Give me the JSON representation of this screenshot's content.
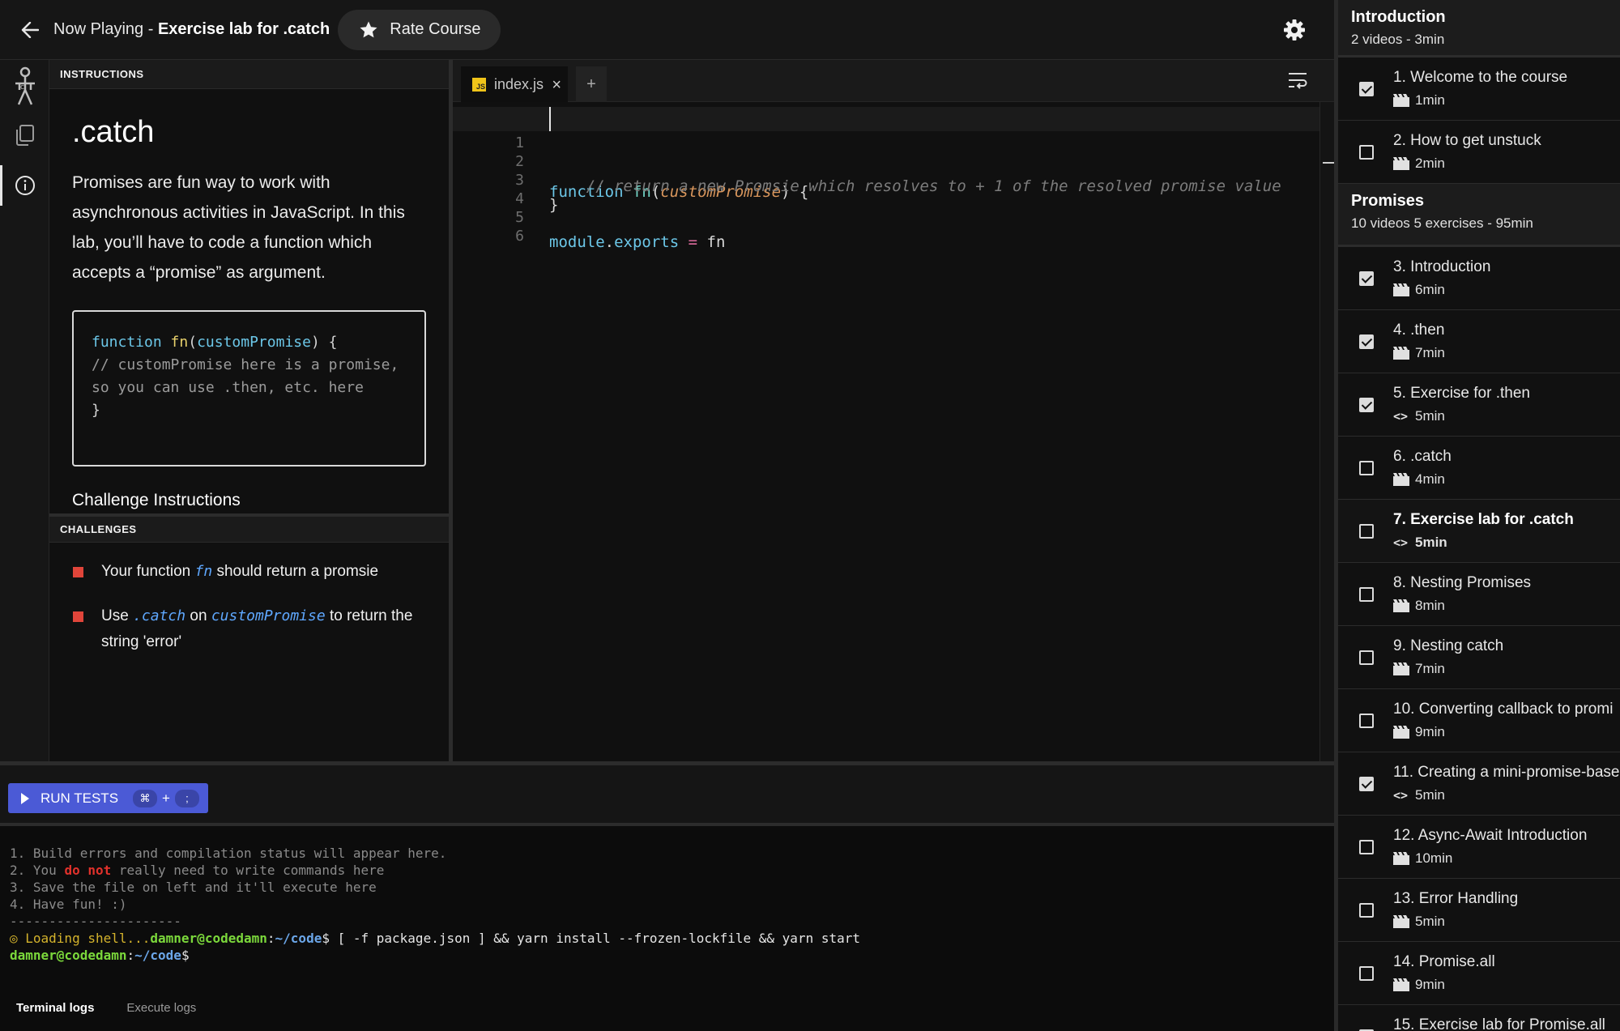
{
  "header": {
    "prefix": "Now Playing - ",
    "title": "Exercise lab for .catch",
    "rate_label": "Rate Course"
  },
  "instructions": {
    "panel_label": "INSTRUCTIONS",
    "title": ".catch",
    "description": "Promises are fun way to work with asynchronous activities in JavaScript. In this lab, you’ll have to code a function which accepts a “promise” as argument.",
    "code_sample": {
      "line1_kw": "function",
      "line1_fn": "fn",
      "line1_param": "customPromise",
      "comment": "// customPromise here is a promise, so you can use .then, etc. here",
      "close": "}"
    },
    "challenge_heading": "Challenge Instructions"
  },
  "challenges": {
    "panel_label": "CHALLENGES",
    "items": [
      {
        "pre": "Your function ",
        "code": "fn",
        "post": " should return a promsie"
      },
      {
        "pre": "Use ",
        "code": ".catch",
        "mid": " on ",
        "code2": "customPromise",
        "post": " to return the string 'error'"
      }
    ],
    "status_color": "#e0453a"
  },
  "editor": {
    "tab_name": "index.js",
    "tab_icon": "JS",
    "add_tab": "+",
    "lines": [
      {
        "n": "1",
        "kw": "function",
        "fn": "fn",
        "param": "customPromise",
        "tail": ") {"
      },
      {
        "n": "2",
        "comment": "    // return a new Promsie which resolves to + 1 of the resolved promise value"
      },
      {
        "n": "3",
        "text": "}"
      },
      {
        "n": "4",
        "text": ""
      },
      {
        "n": "5",
        "v1": "module",
        "dot": ".",
        "v2": "exports",
        "op": " = ",
        "rest": "fn"
      },
      {
        "n": "6",
        "text": ""
      }
    ]
  },
  "run": {
    "label": "RUN TESTS",
    "key1": "⌘",
    "plus": "+",
    "key2": ";"
  },
  "terminal": {
    "l1": "1. Build errors and compilation status will appear here.",
    "l2a": "2. You ",
    "l2b": "do not",
    "l2c": " really need to write commands here",
    "l3": "3. Save the file on left and it'll execute here",
    "l4": "4. Have fun! :)",
    "sep": "----------------------",
    "l6a": "◎ Loading shell...",
    "user": "damner@codedamn",
    "path": "~/code",
    "cmd": " [ -f package.json ] && yarn install --frozen-lockfile && yarn start",
    "dollar": "$",
    "colon": ":",
    "tabs": [
      "Terminal logs",
      "Execute logs"
    ]
  },
  "sidebar": {
    "sections": [
      {
        "title": "Introduction",
        "sub": "2 videos - 3min",
        "lessons": [
          {
            "label": "1. Welcome to the course",
            "duration": "1min",
            "kind": "video",
            "done": true
          },
          {
            "label": "2. How to get unstuck",
            "duration": "2min",
            "kind": "video",
            "done": false
          }
        ]
      },
      {
        "title": "Promises",
        "sub": "10 videos 5 exercises - 95min",
        "lessons": [
          {
            "label": "3. Introduction",
            "duration": "6min",
            "kind": "video",
            "done": true
          },
          {
            "label": "4. .then",
            "duration": "7min",
            "kind": "video",
            "done": true
          },
          {
            "label": "5. Exercise for .then",
            "duration": "5min",
            "kind": "code",
            "done": true
          },
          {
            "label": "6. .catch",
            "duration": "4min",
            "kind": "video",
            "done": false
          },
          {
            "label": "7. Exercise lab for .catch",
            "duration": "5min",
            "kind": "code",
            "done": false,
            "current": true
          },
          {
            "label": "8. Nesting Promises",
            "duration": "8min",
            "kind": "video",
            "done": false
          },
          {
            "label": "9. Nesting catch",
            "duration": "7min",
            "kind": "video",
            "done": false
          },
          {
            "label": "10. Converting callback to promi",
            "duration": "9min",
            "kind": "video",
            "done": false
          },
          {
            "label": "11. Creating a mini-promise-base",
            "duration": "5min",
            "kind": "code",
            "done": true
          },
          {
            "label": "12. Async-Await Introduction",
            "duration": "10min",
            "kind": "video",
            "done": false
          },
          {
            "label": "13. Error Handling",
            "duration": "5min",
            "kind": "video",
            "done": false
          },
          {
            "label": "14. Promise.all",
            "duration": "9min",
            "kind": "video",
            "done": false
          },
          {
            "label": "15. Exercise lab for Promise.all",
            "duration": "",
            "kind": "code",
            "done": false
          }
        ]
      }
    ]
  }
}
